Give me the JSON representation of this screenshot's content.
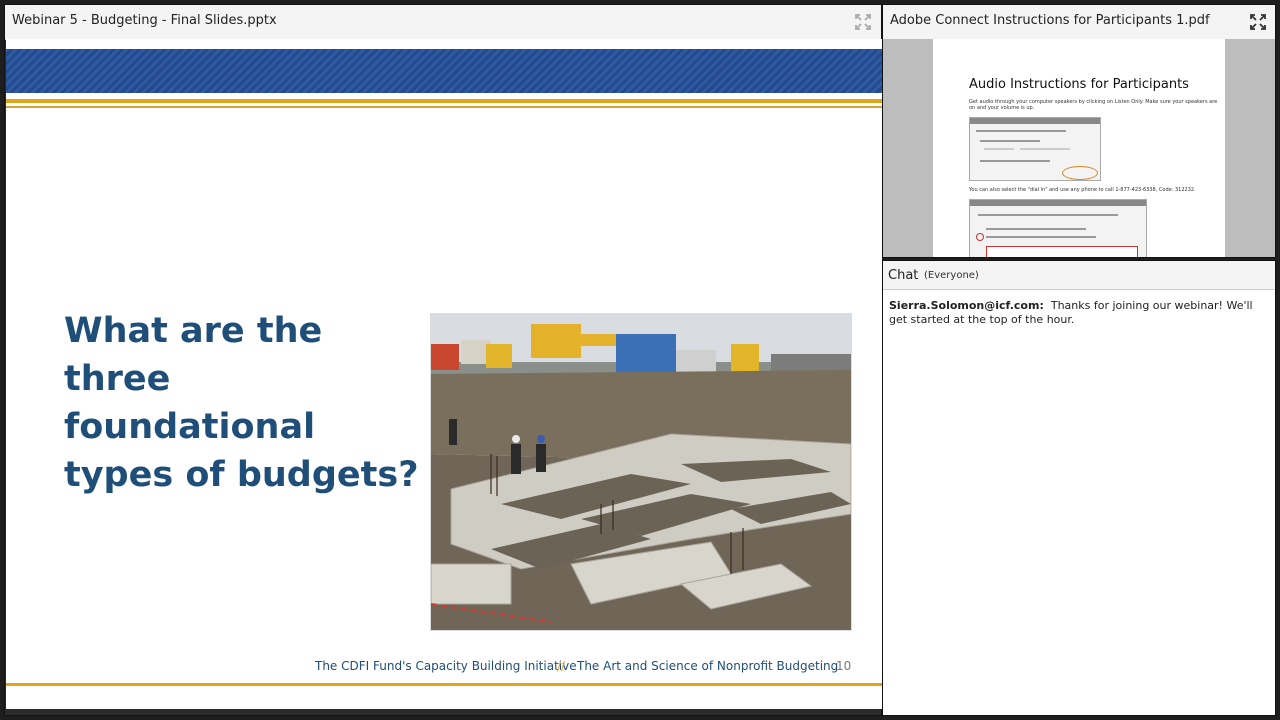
{
  "slides_pod": {
    "title": "Webinar 5 - Budgeting - Final Slides.pptx",
    "fullscreen_icon": "fullscreen-icon",
    "slide": {
      "question": "What are the three foundational types of budgets?",
      "photo": "construction-foundation-photo",
      "footer_left": "The CDFI Fund's Capacity Building Initiative",
      "footer_separator": "//",
      "footer_right": "The Art and Science of Nonprofit Budgeting",
      "page_number": "10"
    },
    "colors": {
      "title_blue": "#1f4e79",
      "gold": "#e0a51b",
      "banner_blue": "#2d5aa3"
    }
  },
  "pdf_pod": {
    "title": "Adobe Connect Instructions for Participants 1.pdf",
    "fullscreen_icon": "fullscreen-icon",
    "page": {
      "heading": "Audio Instructions for Participants",
      "text1": "Get audio through your computer speakers by clicking on Listen Only. Make sure your speakers are on and your volume is up.",
      "text2": "You can also select the \"dial in\" and use any phone to call 1-877-423-6338, Code: 312232."
    }
  },
  "chat_pod": {
    "title": "Chat",
    "scope": "(Everyone)",
    "messages": [
      {
        "sender": "Sierra.Solomon@icf.com:",
        "text": "Thanks for joining our webinar! We'll get started at the top of the hour."
      }
    ]
  }
}
